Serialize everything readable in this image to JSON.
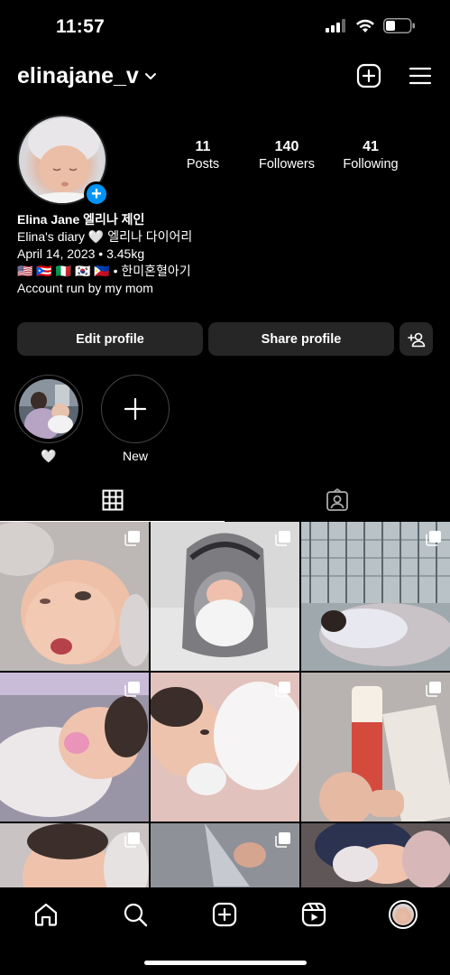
{
  "status": {
    "time": "11:57"
  },
  "header": {
    "username": "elinajane_v"
  },
  "profile": {
    "stats": [
      {
        "number": "11",
        "label": "Posts"
      },
      {
        "number": "140",
        "label": "Followers"
      },
      {
        "number": "41",
        "label": "Following"
      }
    ],
    "bio": {
      "name": "Elina Jane 엘리나 제인",
      "line1": "Elina's diary 🤍 엘리나 다이어리",
      "line2": "April 14, 2023 • 3.45kg",
      "line3": "🇺🇸 🇵🇷 🇮🇹 🇰🇷 🇵🇭 • 한미혼혈아기",
      "line4": "Account run by my mom"
    }
  },
  "actions": {
    "edit": "Edit profile",
    "share": "Share profile"
  },
  "highlights": [
    {
      "label": "🤍"
    },
    {
      "label": "New"
    }
  ],
  "colors": {
    "accent": "#0095f6",
    "button": "#262626",
    "background": "#000000"
  }
}
